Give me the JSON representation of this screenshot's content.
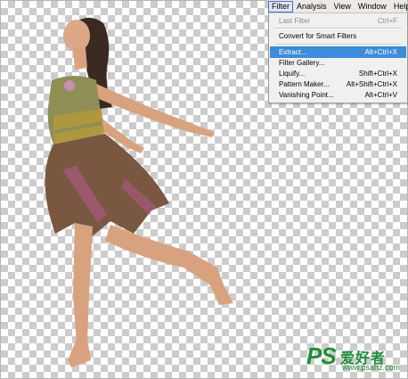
{
  "menubar": {
    "items": [
      {
        "label": "Filter",
        "active": true
      },
      {
        "label": "Analysis"
      },
      {
        "label": "View"
      },
      {
        "label": "Window"
      },
      {
        "label": "Help"
      }
    ]
  },
  "filter_menu": {
    "items": [
      {
        "label": "Last Filter",
        "shortcut": "Ctrl+F",
        "disabled": true
      },
      {
        "label": "Convert for Smart Filters",
        "shortcut": ""
      },
      {
        "label": "Extract...",
        "shortcut": "Alt+Ctrl+X",
        "highlighted": true
      },
      {
        "label": "Filter Gallery...",
        "shortcut": ""
      },
      {
        "label": "Liquify...",
        "shortcut": "Shift+Ctrl+X"
      },
      {
        "label": "Pattern Maker...",
        "shortcut": "Alt+Shift+Ctrl+X"
      },
      {
        "label": "Vanishing Point...",
        "shortcut": "Alt+Ctrl+V"
      }
    ]
  },
  "watermark": {
    "logo": "PS",
    "chinese": "爱好者",
    "url": "www.psahz.com"
  },
  "colors": {
    "highlight": "#3c8cd9",
    "watermark": "#1e8f3a",
    "menu_bg": "#f0f0f0"
  }
}
